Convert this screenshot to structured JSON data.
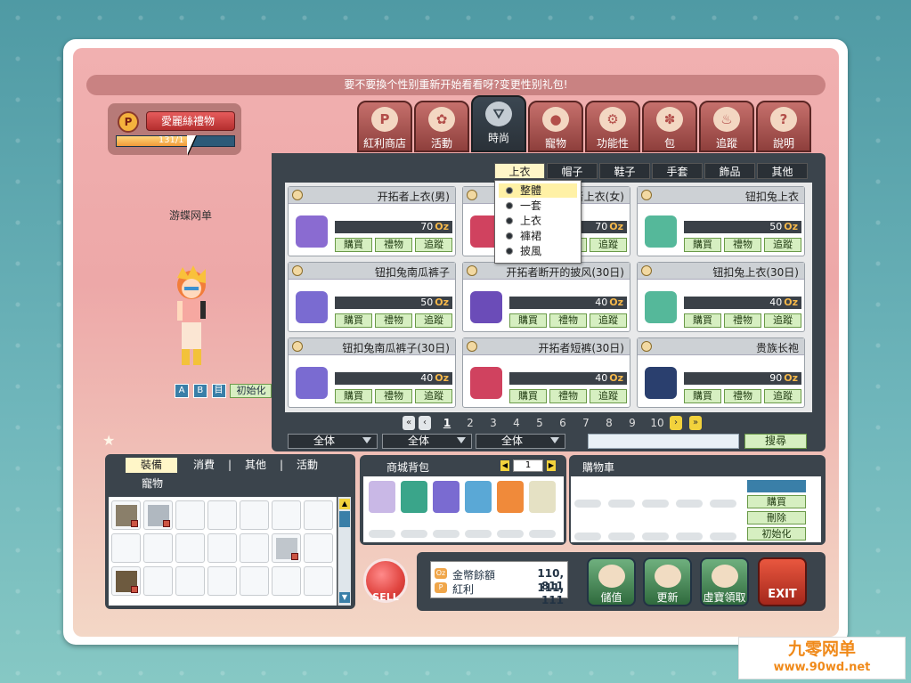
{
  "notice": "要不要換个性别重新开始看看呀?变更性别礼包!",
  "gift": {
    "coin": "P",
    "button": "愛麗絲禮物",
    "count": "131/1 3"
  },
  "character": {
    "name": "游蝶网单",
    "reset": "初始化",
    "buttons": [
      "A",
      "B",
      "目"
    ]
  },
  "tabs": [
    "紅利商店",
    "活動",
    "時尚",
    "寵物",
    "功能性",
    "包",
    "追蹤",
    "說明"
  ],
  "active_tab": "時尚",
  "subtabs": [
    "上衣",
    "帽子",
    "鞋子",
    "手套",
    "飾品",
    "其他"
  ],
  "dropdown": [
    "整體",
    "一套",
    "上衣",
    "褲裙",
    "披風"
  ],
  "card_buttons": {
    "buy": "購買",
    "gift": "禮物",
    "track": "追蹤"
  },
  "currency": "Oz",
  "items": [
    {
      "name": "开拓者上衣(男)",
      "price": "70"
    },
    {
      "name": "开拓者上衣(女)",
      "price": "70"
    },
    {
      "name": "钮扣兔上衣",
      "price": "50"
    },
    {
      "name": "钮扣兔南瓜裤子",
      "price": "50"
    },
    {
      "name": "开拓者断开的披风(30日)",
      "price": "40"
    },
    {
      "name": "钮扣兔上衣(30日)",
      "price": "40"
    },
    {
      "name": "钮扣兔南瓜裤子(30日)",
      "price": "40"
    },
    {
      "name": "开拓者短裤(30日)",
      "price": "40"
    },
    {
      "name": "贵族长袍",
      "price": "90"
    }
  ],
  "item_colors": [
    "#8a6bd1",
    "#d0425f",
    "#55b89a",
    "#7a6bd1",
    "#6b4cb8",
    "#55b89a",
    "#7a6bd1",
    "#d0425f",
    "#2a3f6e"
  ],
  "pages": [
    "1",
    "2",
    "3",
    "4",
    "5",
    "6",
    "7",
    "8",
    "9",
    "10"
  ],
  "current_page": "1",
  "filters": [
    "全体",
    "全体",
    "全体"
  ],
  "search_button": "搜尋",
  "inventory": {
    "tabs": [
      "裝備",
      "消費",
      "其他",
      "活動",
      "寵物"
    ],
    "separators": [
      "|",
      "|",
      "|"
    ]
  },
  "bag": {
    "title": "商城背包",
    "page": "1"
  },
  "cart": {
    "title": "購物車",
    "buttons": [
      "購買",
      "刪除",
      "初始化"
    ]
  },
  "wallet": {
    "gold_label": "金幣餘額",
    "gold": "110, 811",
    "bonus_label": "紅利",
    "bonus": "111, 111"
  },
  "actions": [
    "儲值",
    "更新",
    "虛寶領取"
  ],
  "exit": "EXIT",
  "sell": "SELL",
  "watermark": {
    "line1": "九零网单",
    "line2": "www.90wd.net"
  }
}
